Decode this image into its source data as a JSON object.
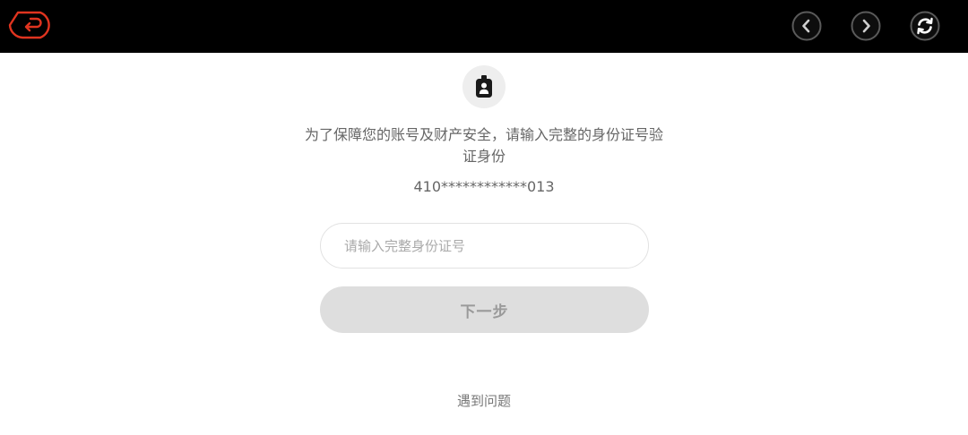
{
  "topbar": {
    "back_icon": "return-arrow-icon",
    "back_color": "#e0341f",
    "prev_icon": "chevron-left-icon",
    "next_icon": "chevron-right-icon",
    "refresh_icon": "refresh-icon"
  },
  "verify": {
    "avatar_icon": "id-badge-icon",
    "prompt": "为了保障您的账号及财产安全，请输入完整的身份证号验证身份",
    "masked_id": "410************013",
    "input_placeholder": "请输入完整身份证号",
    "input_value": "",
    "next_label": "下一步",
    "help_label": "遇到问题"
  }
}
